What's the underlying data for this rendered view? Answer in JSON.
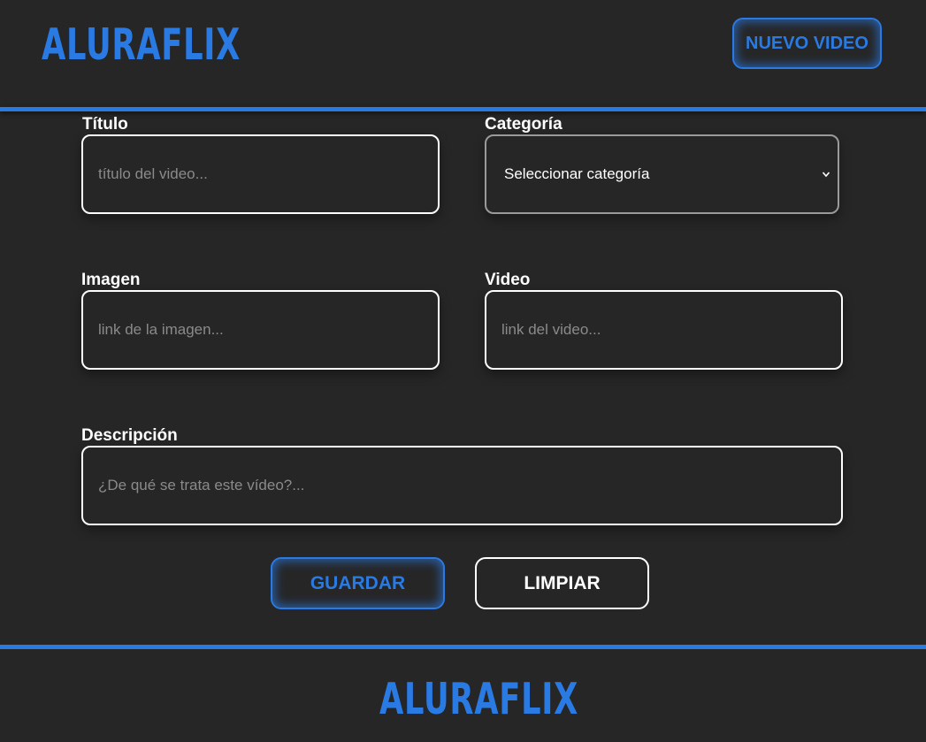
{
  "header": {
    "logo": "ALURAFLIX",
    "new_video_label": "NUEVO VIDEO"
  },
  "form": {
    "titulo": {
      "label": "Título",
      "placeholder": "título del video..."
    },
    "categoria": {
      "label": "Categoría",
      "selected": "Seleccionar categoría"
    },
    "imagen": {
      "label": "Imagen",
      "placeholder": "link de la imagen..."
    },
    "video": {
      "label": "Video",
      "placeholder": "link del video..."
    },
    "descripcion": {
      "label": "Descripción",
      "placeholder": "¿De qué se trata este vídeo?..."
    },
    "save_label": "GUARDAR",
    "clear_label": "LIMPIAR"
  },
  "footer": {
    "logo": "ALURAFLIX"
  },
  "colors": {
    "background": "#262626",
    "accent": "#2a7ae4",
    "text": "#ffffff",
    "placeholder": "#8a8a8a"
  }
}
